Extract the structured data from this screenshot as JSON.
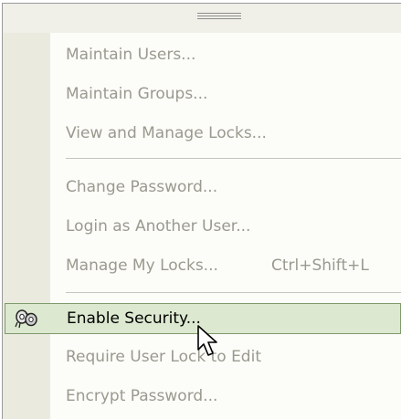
{
  "menu": {
    "items": [
      {
        "label": "Maintain Users...",
        "shortcut": "",
        "enabled": false
      },
      {
        "label": "Maintain Groups...",
        "shortcut": "",
        "enabled": false
      },
      {
        "label": "View and Manage Locks...",
        "shortcut": "",
        "enabled": false
      },
      {
        "label": "Change Password...",
        "shortcut": "",
        "enabled": false
      },
      {
        "label": "Login as Another User...",
        "shortcut": "",
        "enabled": false
      },
      {
        "label": "Manage My Locks...",
        "shortcut": "Ctrl+Shift+L",
        "enabled": false
      },
      {
        "label": "Enable Security...",
        "shortcut": "",
        "enabled": true,
        "icon": "security-key-icon"
      },
      {
        "label": "Require User Lock to Edit",
        "shortcut": "",
        "enabled": false
      },
      {
        "label": "Encrypt Password...",
        "shortcut": "",
        "enabled": false
      }
    ]
  },
  "icons": {
    "grip": "drag-grip-icon",
    "security": "security-key-icon",
    "cursor": "mouse-pointer-icon"
  },
  "colors": {
    "disabled_text": "#9a9a8f",
    "highlight_bg": "#dce8cf",
    "highlight_border": "#7e9b6b",
    "gutter": "#ebeadf"
  }
}
